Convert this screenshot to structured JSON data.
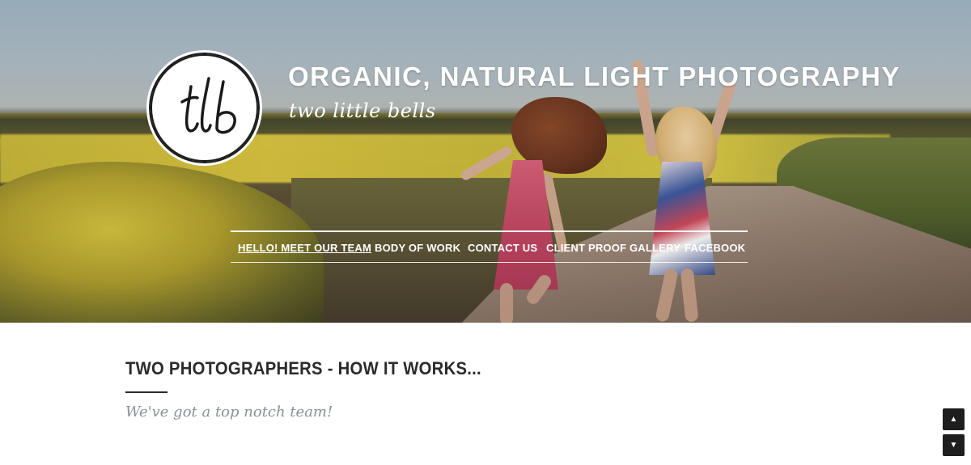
{
  "header": {
    "site_title": "ORGANIC, NATURAL LIGHT PHOTOGRAPHY",
    "tagline": "two little bells",
    "logo_text": "tlb"
  },
  "nav": {
    "items": [
      {
        "label": "HELLO! MEET OUR TEAM",
        "active": true
      },
      {
        "label": "BODY OF WORK",
        "active": false
      },
      {
        "label": "CONTACT US",
        "active": false
      },
      {
        "label": "CLIENT PROOF GALLERY",
        "active": false
      },
      {
        "label": "FACEBOOK",
        "active": false
      }
    ]
  },
  "content": {
    "heading": "TWO PHOTOGRAPHERS - HOW IT WORKS...",
    "subheading": "We've got a top notch team!"
  },
  "scroll": {
    "up_icon": "▲",
    "down_icon": "▼"
  },
  "colors": {
    "accent_dark": "#1e1e1e",
    "heading_text": "#2b2b2b",
    "subheading_text": "#8a9197"
  }
}
